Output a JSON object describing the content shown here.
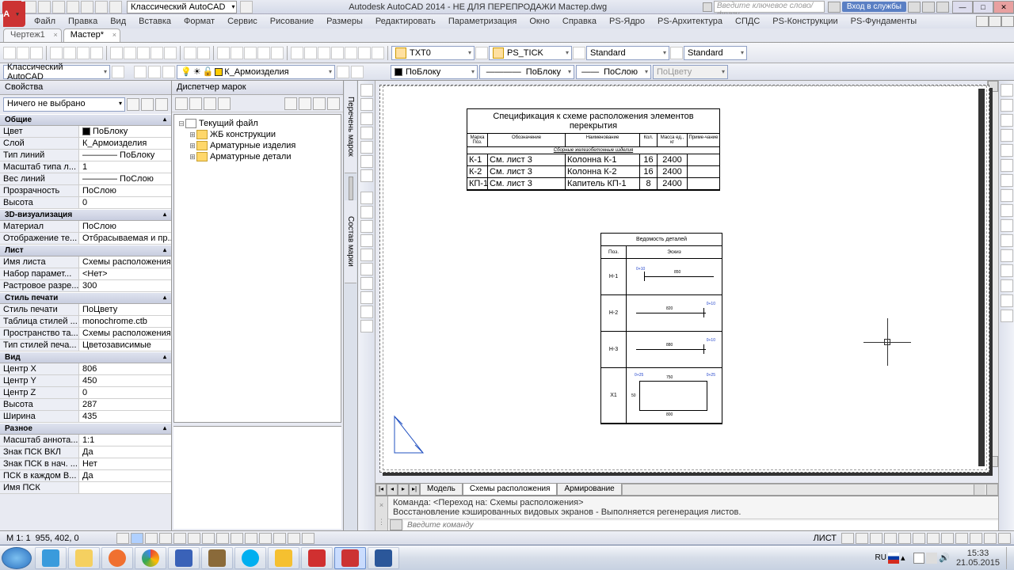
{
  "titlebar": {
    "workspace": "Классический AutoCAD",
    "title": "Autodesk AutoCAD 2014 - НЕ ДЛЯ ПЕРЕПРОДАЖИ   Мастер.dwg",
    "search_placeholder": "Введите ключевое слово/фразу",
    "signin": "Вход в службы"
  },
  "menu": {
    "items": [
      "Файл",
      "Правка",
      "Вид",
      "Вставка",
      "Формат",
      "Сервис",
      "Рисование",
      "Размеры",
      "Редактировать",
      "Параметризация",
      "Окно",
      "Справка",
      "PS-Ядро",
      "PS-Архитектура",
      "СПДС",
      "PS-Конструкции",
      "PS-Фундаменты"
    ]
  },
  "tabs": {
    "tab1": "Чертеж1",
    "tab2": "Мастер*"
  },
  "toolbar": {
    "textstyle": "TXT0",
    "dimstyle": "PS_TICK",
    "tablestyle": "Standard",
    "mlstyle": "Standard",
    "workspace2": "Классический AutoCAD",
    "layer": "К_Армоизделия",
    "color": "ПоБлоку",
    "linetype": "ПоБлоку",
    "lineweight": "ПоСлою",
    "plotstyle": "ПоЦвету"
  },
  "props": {
    "title": "Свойства",
    "selection": "Ничего не выбрано",
    "cat_general": "Общие",
    "general": [
      [
        "Цвет",
        "ПоБлоку"
      ],
      [
        "Слой",
        "К_Армоизделия"
      ],
      [
        "Тип линий",
        "———— ПоБлоку"
      ],
      [
        "Масштаб типа л...",
        "1"
      ],
      [
        "Вес линий",
        "———— ПоСлою"
      ],
      [
        "Прозрачность",
        "ПоСлою"
      ],
      [
        "Высота",
        "0"
      ]
    ],
    "cat_3d": "3D-визуализация",
    "viz": [
      [
        "Материал",
        "ПоСлою"
      ],
      [
        "Отображение те...",
        "Отбрасываемая и пр..."
      ]
    ],
    "cat_sheet": "Лист",
    "sheet": [
      [
        "Имя листа",
        "Схемы расположения"
      ],
      [
        "Набор парамет...",
        "<Нет>"
      ],
      [
        "Растровое разре...",
        "300"
      ]
    ],
    "cat_plot": "Стиль печати",
    "plot": [
      [
        "Стиль печати",
        "ПоЦвету"
      ],
      [
        "Таблица стилей ...",
        "monochrome.ctb"
      ],
      [
        "Пространство та...",
        "Схемы расположения"
      ],
      [
        "Тип стилей печа...",
        "Цветозависимые"
      ]
    ],
    "cat_view": "Вид",
    "view": [
      [
        "Центр X",
        "806"
      ],
      [
        "Центр Y",
        "450"
      ],
      [
        "Центр Z",
        "0"
      ],
      [
        "Высота",
        "287"
      ],
      [
        "Ширина",
        "435"
      ]
    ],
    "cat_misc": "Разное",
    "misc": [
      [
        "Масштаб аннота...",
        "1:1"
      ],
      [
        "Знак ПСК ВКЛ",
        "Да"
      ],
      [
        "Знак ПСК в нач. ...",
        "Нет"
      ],
      [
        "ПСК в каждом В...",
        "Да"
      ],
      [
        "Имя ПСК",
        ""
      ]
    ]
  },
  "markup": {
    "title": "Диспетчер марок",
    "root": "Текущий файл",
    "n1": "ЖБ конструкции",
    "n2": "Арматурные изделия",
    "n3": "Арматурные детали",
    "sidetab1": "Перечень марок",
    "sidetab2": "Состав марки"
  },
  "spec": {
    "title": "Спецификация к схеме расположения элементов перекрытия",
    "h1": "Марка Поз.",
    "h2": "Обозначение",
    "h3": "Наименование",
    "h4": "Кол.",
    "h5": "Масса ед., кг",
    "h6": "Приме-чание",
    "subhdr": "Сборные железобетонные изделия",
    "rows": [
      [
        "К-1",
        "См. лист 3",
        "Колонна К-1",
        "16",
        "2400",
        ""
      ],
      [
        "К-2",
        "См. лист 3",
        "Колонна К-2",
        "16",
        "2400",
        ""
      ],
      [
        "КП-1",
        "См. лист 3",
        "Капитель КП-1",
        "8",
        "2400",
        ""
      ]
    ]
  },
  "details": {
    "title": "Ведомость деталей",
    "h1": "Поз.",
    "h2": "Эскиз",
    "rows": [
      "Н-1",
      "Н-2",
      "Н-3",
      "X1"
    ]
  },
  "layouts": {
    "l1": "Модель",
    "l2": "Схемы расположения",
    "l3": "Армирование"
  },
  "cmd": {
    "line1": "Команда:  <Переход на: Схемы расположения>",
    "line2": "Восстановление кэшированных видовых экранов - Выполняется регенерация листов.",
    "placeholder": "Введите команду"
  },
  "status": {
    "scale": "М 1:  1",
    "coords": "955, 402, 0",
    "mode": "ЛИСТ"
  },
  "taskbar": {
    "lang": "RU",
    "time": "15:33",
    "date": "21.05.2015"
  }
}
